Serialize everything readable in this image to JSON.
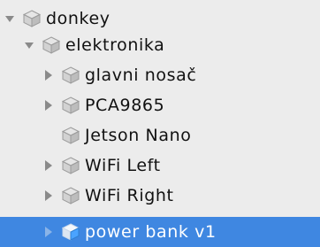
{
  "hierarchy": {
    "items": [
      {
        "label": "donkey",
        "expanded": true,
        "has_children": true,
        "depth": 0,
        "selected": false,
        "icon": "gameobject-cube-icon"
      },
      {
        "label": "elektronika",
        "expanded": true,
        "has_children": true,
        "depth": 1,
        "selected": false,
        "icon": "gameobject-cube-icon"
      },
      {
        "label": "glavni nosač",
        "expanded": false,
        "has_children": true,
        "depth": 2,
        "selected": false,
        "icon": "gameobject-cube-icon"
      },
      {
        "label": "PCA9865",
        "expanded": false,
        "has_children": true,
        "depth": 2,
        "selected": false,
        "icon": "gameobject-cube-icon"
      },
      {
        "label": "Jetson Nano",
        "expanded": false,
        "has_children": false,
        "depth": 2,
        "selected": false,
        "icon": "gameobject-cube-icon"
      },
      {
        "label": "WiFi Left",
        "expanded": false,
        "has_children": true,
        "depth": 2,
        "selected": false,
        "icon": "gameobject-cube-icon"
      },
      {
        "label": "WiFi Right",
        "expanded": false,
        "has_children": true,
        "depth": 2,
        "selected": false,
        "icon": "gameobject-cube-icon"
      },
      {
        "label": "power bank v1",
        "expanded": false,
        "has_children": true,
        "depth": 2,
        "selected": true,
        "icon": "prefab-cube-icon"
      }
    ]
  },
  "colors": {
    "background": "#ececec",
    "selection": "#3f87e1",
    "text": "#111111",
    "selected_text": "#ffffff",
    "arrow": "#8a8a8a"
  }
}
